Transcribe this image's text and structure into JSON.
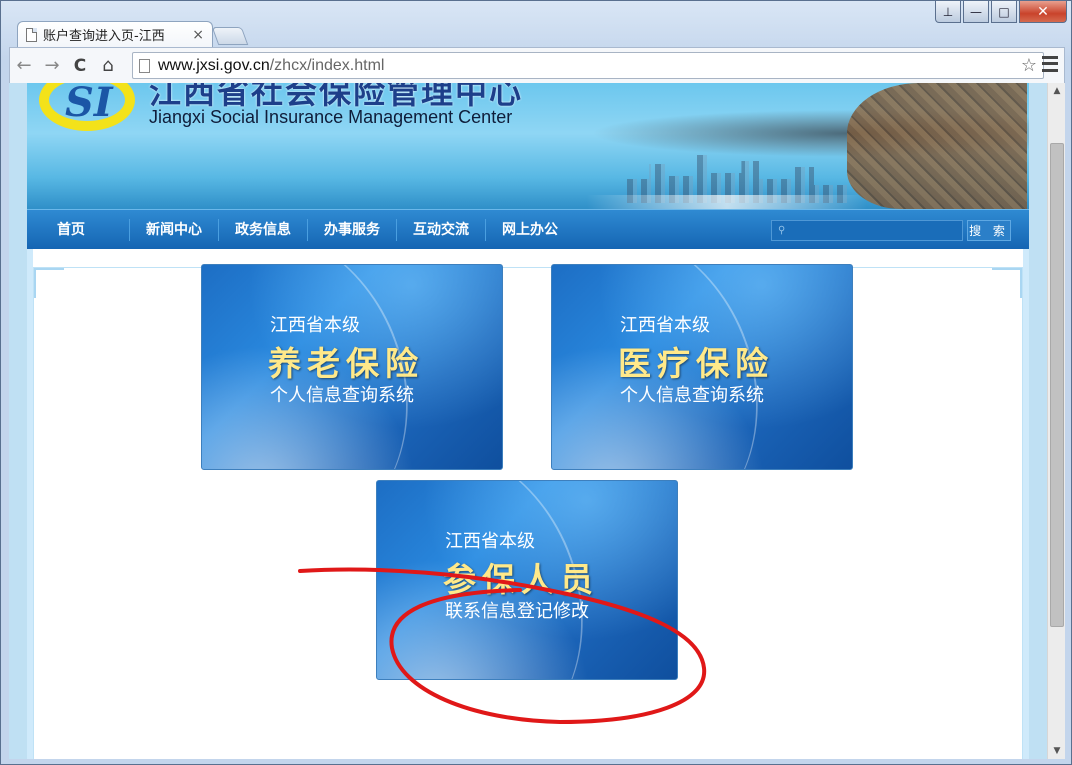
{
  "browser": {
    "tab_title": "账户查询进入页-江西",
    "tab_close": "×",
    "url_host": "www.jxsi.gov.cn",
    "url_path": "/zhcx/index.html",
    "back": "←",
    "forward": "→",
    "reload": "C",
    "home": "⌂",
    "star": "☆",
    "window_buttons": {
      "user": "⊥",
      "min": "—",
      "max": "□",
      "close": "✕"
    }
  },
  "site": {
    "name_cn": "江西省社会保险管理中心",
    "name_en": "Jiangxi Social Insurance Management Center",
    "logo_text": "SI",
    "nav": [
      "首页",
      "新闻中心",
      "政务信息",
      "办事服务",
      "互动交流",
      "网上办公"
    ],
    "search_placeholder": "",
    "search_button": "搜 索"
  },
  "cards": {
    "pension": {
      "line1": "江西省本级",
      "line2": "养老保险",
      "line3": "个人信息查询系统"
    },
    "medical": {
      "line1": "江西省本级",
      "line2": "医疗保险",
      "line3": "个人信息查询系统"
    },
    "insured": {
      "line1": "江西省本级",
      "line2": "参保人员",
      "line3": "联系信息登记修改"
    }
  },
  "colors": {
    "nav_bar": "#1565b3",
    "card_title": "#ffe98a",
    "annotation": "#e01818"
  }
}
